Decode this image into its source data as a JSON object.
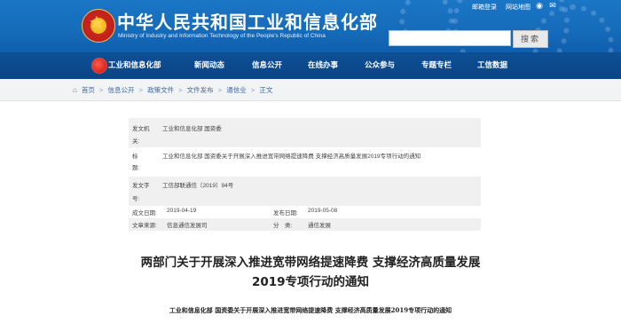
{
  "header": {
    "title": "中华人民共和国工业和信息化部",
    "subtitle": "Ministry of Industry and Information Technology of the People's Republic of China",
    "top_links": [
      "邮箱登录",
      "网站地图"
    ],
    "search_button": "搜索",
    "search_placeholder": ""
  },
  "nav": {
    "items": [
      "工业和信息化部",
      "新闻动态",
      "信息公开",
      "在线办事",
      "公众参与",
      "专题专栏",
      "工信数据"
    ]
  },
  "breadcrumb": {
    "items": [
      "首页",
      "信息公开",
      "政策文件",
      "文件发布",
      "通信业",
      "正文"
    ],
    "separator": ">"
  },
  "document_info": {
    "issuer_label": "发文机",
    "issuer_label_2": "关:",
    "issuer_value": "工业和信息化部 国资委",
    "title_label": "标",
    "title_label_2": "题:",
    "title_value": "工业和信息化部 国资委关于开展深入推进宽带网络提速降费 支撑经济高质量发展2019专项行动的通知",
    "number_label": "发文字",
    "number_label_2": "号:",
    "number_value": "工信部联通信〔2019〕94号",
    "created_label": "成文日期:",
    "created_value": "2019-04-19",
    "published_label": "发布日期:",
    "published_value": "2019-05-08",
    "source_label": "文章来源:",
    "source_value": "信息通信发展司",
    "category_label": "分　类:",
    "category_value": "通信发展"
  },
  "article": {
    "headline_line1": "两部门关于开展深入推进宽带网络提速降费 支撑经济高质量发展",
    "headline_line2": "2019专项行动的通知",
    "subline": "工业和信息化部 国资委关于开展深入推进宽带网络提速降费 支撑经济高质量发展2019专项行动的通知"
  }
}
